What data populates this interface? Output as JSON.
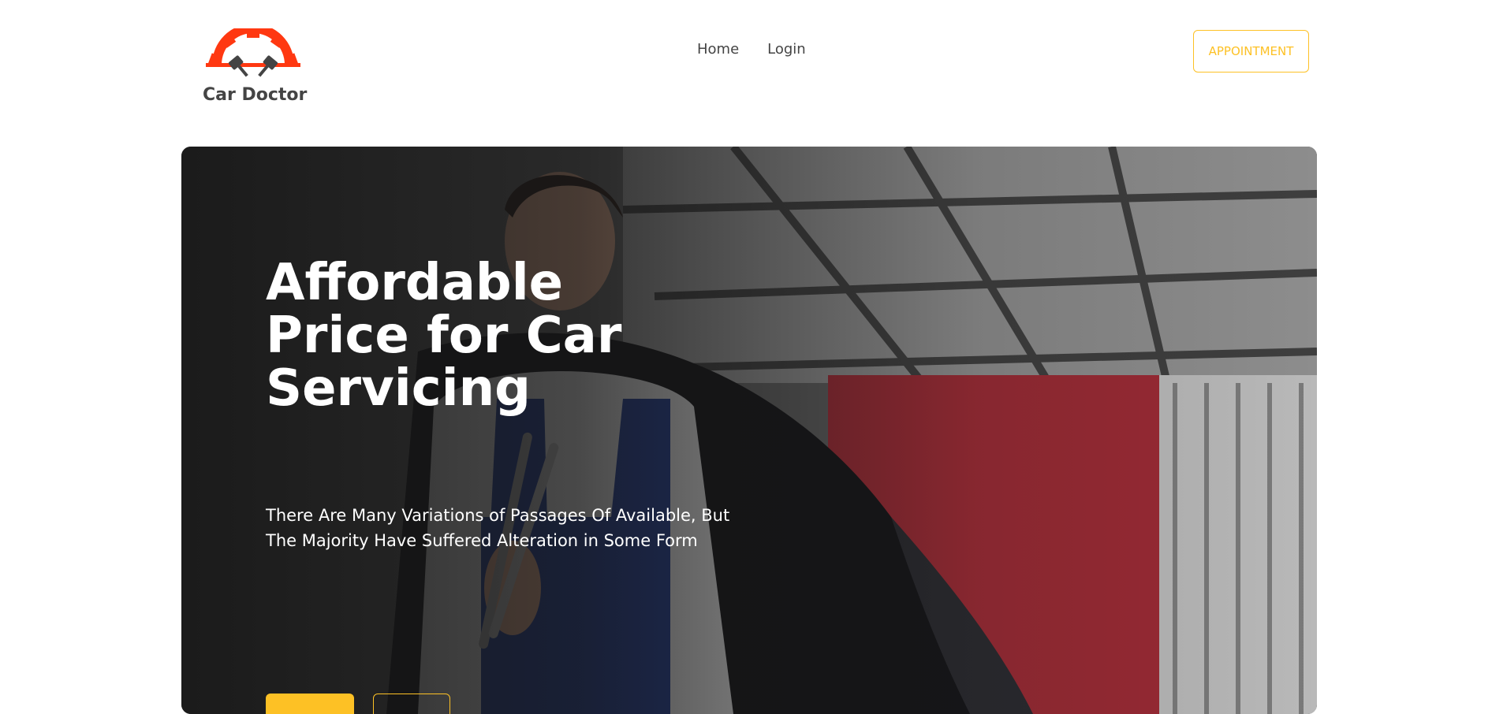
{
  "brand": {
    "name": "Car Doctor",
    "logo_icon": "gear-pistons-icon",
    "logo_color": "#FF3811"
  },
  "nav": {
    "items": [
      {
        "label": "Home"
      },
      {
        "label": "Login"
      }
    ]
  },
  "header": {
    "cta_label": "APPOINTMENT"
  },
  "hero": {
    "title": "Affordable Price for Car Servicing",
    "description": "There Are Many Variations of Passages Of Available, But The Majority Have Suffered Alteration in Some Form",
    "primary_button_label": "",
    "secondary_button_label": ""
  },
  "colors": {
    "accent": "#FDC125",
    "brand_red": "#FF3811",
    "text_dark": "#444444"
  }
}
